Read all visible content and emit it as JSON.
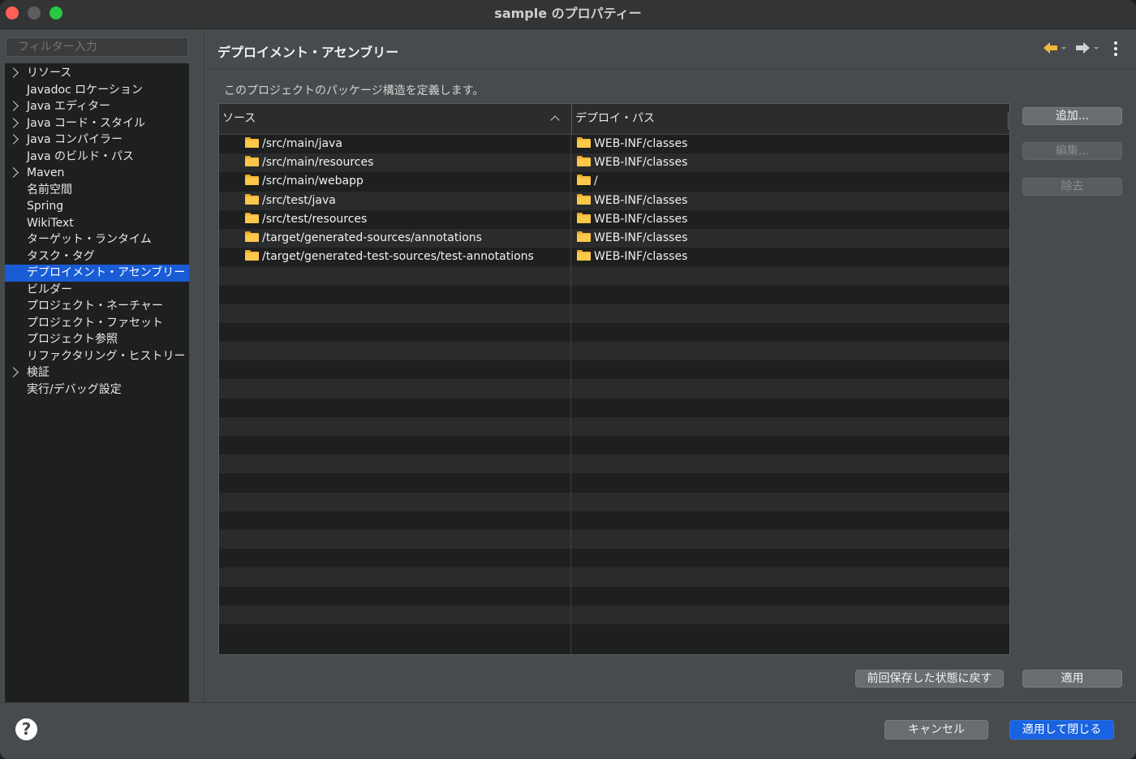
{
  "window": {
    "title": "sample のプロパティー"
  },
  "left": {
    "filter_placeholder": "フィルター入力",
    "items": [
      {
        "label": "リソース",
        "expandable": true
      },
      {
        "label": "Javadoc ロケーション",
        "expandable": false
      },
      {
        "label": "Java エディター",
        "expandable": true
      },
      {
        "label": "Java コード・スタイル",
        "expandable": true
      },
      {
        "label": "Java コンパイラー",
        "expandable": true
      },
      {
        "label": "Java のビルド・パス",
        "expandable": false
      },
      {
        "label": "Maven",
        "expandable": true
      },
      {
        "label": "名前空間",
        "expandable": false
      },
      {
        "label": "Spring",
        "expandable": false
      },
      {
        "label": "WikiText",
        "expandable": false
      },
      {
        "label": "ターゲット・ランタイム",
        "expandable": false
      },
      {
        "label": "タスク・タグ",
        "expandable": false
      },
      {
        "label": "デプロイメント・アセンブリー",
        "expandable": false,
        "selected": true
      },
      {
        "label": "ビルダー",
        "expandable": false
      },
      {
        "label": "プロジェクト・ネーチャー",
        "expandable": false
      },
      {
        "label": "プロジェクト・ファセット",
        "expandable": false
      },
      {
        "label": "プロジェクト参照",
        "expandable": false
      },
      {
        "label": "リファクタリング・ヒストリー",
        "expandable": false
      },
      {
        "label": "検証",
        "expandable": true
      },
      {
        "label": "実行/デバッグ設定",
        "expandable": false
      }
    ]
  },
  "main": {
    "title": "デプロイメント・アセンブリー",
    "description": "このプロジェクトのパッケージ構造を定義します。",
    "table": {
      "columns": [
        "ソース",
        "デプロイ・パス"
      ],
      "rows": [
        {
          "source": "/src/main/java",
          "deploy": "WEB-INF/classes"
        },
        {
          "source": "/src/main/resources",
          "deploy": "WEB-INF/classes"
        },
        {
          "source": "/src/main/webapp",
          "deploy": "/"
        },
        {
          "source": "/src/test/java",
          "deploy": "WEB-INF/classes"
        },
        {
          "source": "/src/test/resources",
          "deploy": "WEB-INF/classes"
        },
        {
          "source": "/target/generated-sources/annotations",
          "deploy": "WEB-INF/classes"
        },
        {
          "source": "/target/generated-test-sources/test-annotations",
          "deploy": "WEB-INF/classes"
        }
      ]
    },
    "buttons": {
      "add": "追加...",
      "edit": "編集...",
      "remove": "除去",
      "restore": "前回保存した状態に戻す",
      "apply": "適用"
    }
  },
  "footer": {
    "help": "?",
    "cancel": "キャンセル",
    "apply_close": "適用して閉じる"
  },
  "colors": {
    "selection": "#1a5cd6",
    "primary_button": "#1a63e0",
    "folder": "#f6b93b",
    "back_arrow": "#f0b73b",
    "forward_arrow": "#cfcfcf"
  },
  "icons": {
    "nav_back": "arrow-left-icon",
    "nav_forward": "arrow-right-icon",
    "menu": "kebab-menu-icon",
    "row": "folder-icon"
  }
}
